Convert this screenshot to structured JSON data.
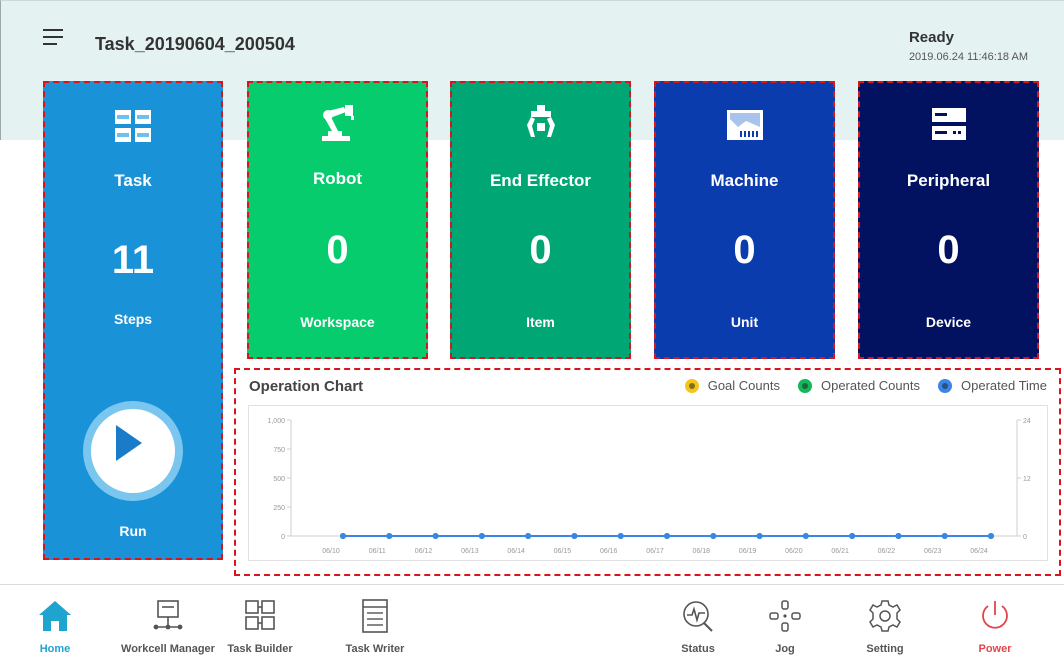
{
  "header": {
    "task_name": "Task_20190604_200504",
    "status": "Ready",
    "datetime": "2019.06.24 11:46:18 AM"
  },
  "tiles": {
    "task": {
      "title": "Task",
      "count": "11",
      "unit": "Steps",
      "run_label": "Run",
      "icon": "task-grid-icon",
      "color": "#1a92d8"
    },
    "robot": {
      "title": "Robot",
      "count": "0",
      "unit": "Workspace",
      "icon": "robot-arm-icon",
      "color": "#06cc6e"
    },
    "end_effector": {
      "title": "End Effector",
      "count": "0",
      "unit": "Item",
      "icon": "gripper-icon",
      "color": "#00a774"
    },
    "machine": {
      "title": "Machine",
      "count": "0",
      "unit": "Unit",
      "icon": "machine-icon",
      "color": "#0a3cae"
    },
    "peripheral": {
      "title": "Peripheral",
      "count": "0",
      "unit": "Device",
      "icon": "server-icon",
      "color": "#021261"
    }
  },
  "chart_data": {
    "type": "line",
    "title": "Operation Chart",
    "categories": [
      "06/10",
      "06/11",
      "06/12",
      "06/13",
      "06/14",
      "06/15",
      "06/16",
      "06/17",
      "06/18",
      "06/19",
      "06/20",
      "06/21",
      "06/22",
      "06/23",
      "06/24"
    ],
    "series": [
      {
        "name": "Goal Counts",
        "color": "#f5c518",
        "axis": "left",
        "values": [
          0,
          0,
          0,
          0,
          0,
          0,
          0,
          0,
          0,
          0,
          0,
          0,
          0,
          0,
          0
        ]
      },
      {
        "name": "Operated Counts",
        "color": "#12b85a",
        "axis": "left",
        "values": [
          0,
          0,
          0,
          0,
          0,
          0,
          0,
          0,
          0,
          0,
          0,
          0,
          0,
          0,
          0
        ]
      },
      {
        "name": "Operated Time",
        "color": "#3a86e8",
        "axis": "right",
        "values": [
          0,
          0,
          0,
          0,
          0,
          0,
          0,
          0,
          0,
          0,
          0,
          0,
          0,
          0,
          0
        ]
      }
    ],
    "left_ticks": [
      "0",
      "250",
      "500",
      "750",
      "1,000"
    ],
    "right_ticks": [
      "0",
      "12",
      "24"
    ],
    "ylim_left": [
      0,
      1000
    ],
    "ylim_right": [
      0,
      24
    ],
    "legend_position": "top-right",
    "grid": false
  },
  "nav": {
    "left": [
      {
        "label": "Home",
        "icon": "home-icon",
        "active": true
      },
      {
        "label": "Workcell Manager",
        "icon": "workcell-icon"
      },
      {
        "label": "Task Builder",
        "icon": "task-builder-icon"
      },
      {
        "label": "Task Writer",
        "icon": "task-writer-icon"
      }
    ],
    "right": [
      {
        "label": "Status",
        "icon": "status-icon"
      },
      {
        "label": "Jog",
        "icon": "jog-icon"
      },
      {
        "label": "Setting",
        "icon": "gear-icon"
      },
      {
        "label": "Power",
        "icon": "power-icon",
        "color": "#e2454a"
      }
    ],
    "active_color": "#1fa3cf"
  }
}
